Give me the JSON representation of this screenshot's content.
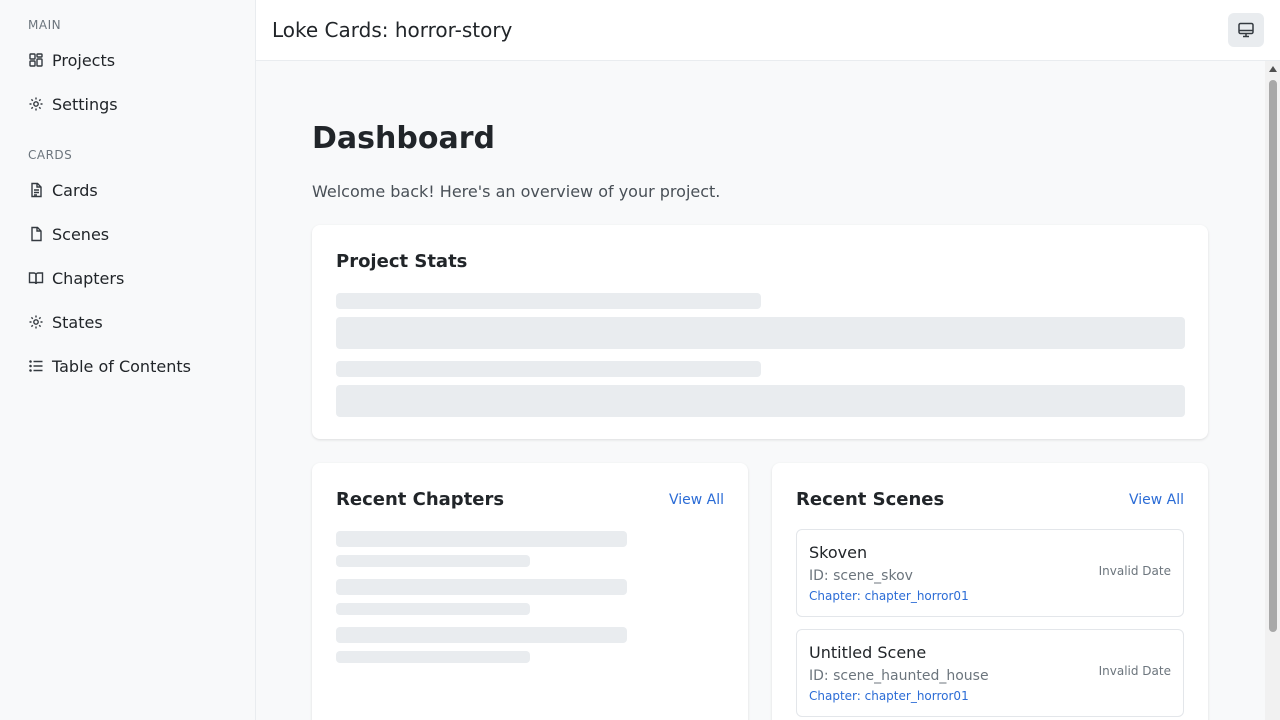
{
  "sidebar": {
    "sections": [
      {
        "title": "MAIN",
        "items": [
          {
            "label": "Projects",
            "icon": "grid-icon"
          },
          {
            "label": "Settings",
            "icon": "gear-icon"
          }
        ]
      },
      {
        "title": "CARDS",
        "items": [
          {
            "label": "Cards",
            "icon": "document-icon"
          },
          {
            "label": "Scenes",
            "icon": "file-icon"
          },
          {
            "label": "Chapters",
            "icon": "book-icon"
          },
          {
            "label": "States",
            "icon": "gear-icon"
          },
          {
            "label": "Table of Contents",
            "icon": "list-icon"
          }
        ]
      }
    ]
  },
  "header": {
    "title": "Loke Cards: horror-story",
    "button_icon": "monitor-icon"
  },
  "page": {
    "title": "Dashboard",
    "subtitle": "Welcome back! Here's an overview of your project."
  },
  "stats": {
    "title": "Project Stats"
  },
  "recent_chapters": {
    "title": "Recent Chapters",
    "view_all": "View All"
  },
  "recent_scenes": {
    "title": "Recent Scenes",
    "view_all": "View All",
    "items": [
      {
        "name": "Skoven",
        "id": "ID: scene_skov",
        "chapter": "Chapter: chapter_horror01",
        "date": "Invalid Date"
      },
      {
        "name": "Untitled Scene",
        "id": "ID: scene_haunted_house",
        "chapter": "Chapter: chapter_horror01",
        "date": "Invalid Date"
      }
    ]
  },
  "colors": {
    "accent": "#2b6cd6",
    "skeleton": "#e9ecef",
    "background": "#f8f9fa"
  }
}
